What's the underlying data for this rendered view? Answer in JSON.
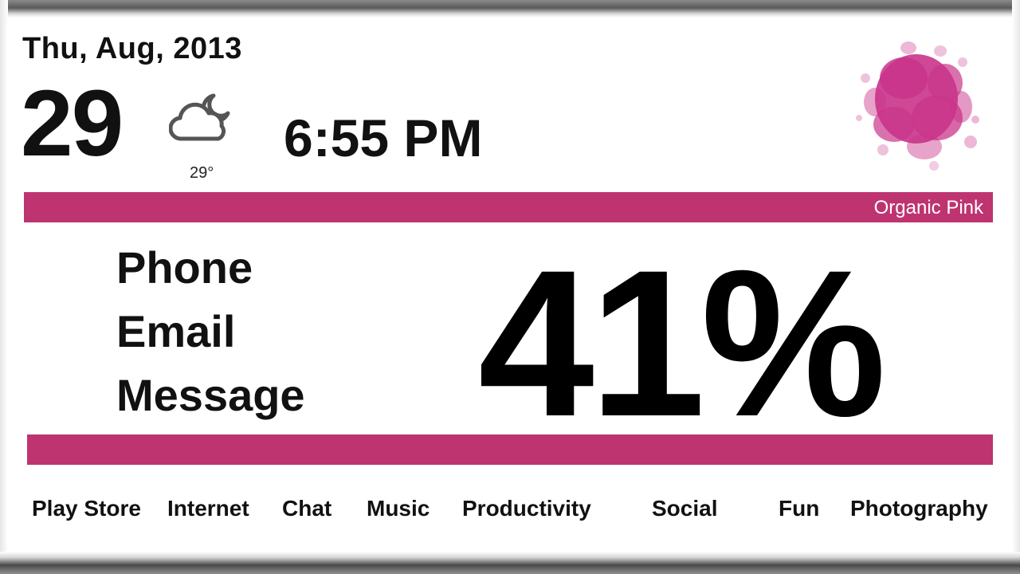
{
  "header": {
    "date": "Thu, Aug, 2013",
    "day_number": "29",
    "weather": {
      "icon": "partly-cloudy-night-icon",
      "temperature": "29°"
    },
    "time": "6:55 PM"
  },
  "theme": {
    "name": "Organic Pink",
    "accent_color": "#be3470"
  },
  "shortcuts": [
    {
      "label": "Phone"
    },
    {
      "label": "Email"
    },
    {
      "label": "Message"
    }
  ],
  "battery": {
    "percent_text": "41%",
    "level": 41
  },
  "apps": [
    {
      "label": "Play Store"
    },
    {
      "label": "Internet"
    },
    {
      "label": "Chat"
    },
    {
      "label": "Music"
    },
    {
      "label": "Productivity"
    },
    {
      "label": "Social"
    },
    {
      "label": "Fun"
    },
    {
      "label": "Photography"
    }
  ]
}
